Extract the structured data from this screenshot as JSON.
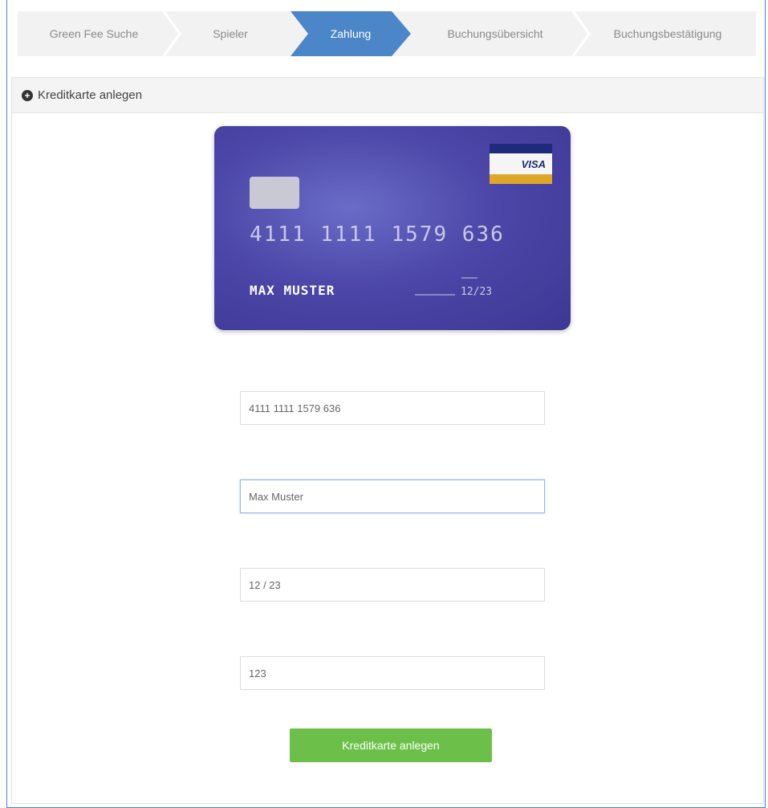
{
  "steps": [
    {
      "label": "Green Fee Suche",
      "active": false
    },
    {
      "label": "Spieler",
      "active": false
    },
    {
      "label": "Zahlung",
      "active": true
    },
    {
      "label": "Buchungsübersicht",
      "active": false
    },
    {
      "label": "Buchungsbestätigung",
      "active": false
    }
  ],
  "panel": {
    "title": "Kreditkarte anlegen",
    "icon": "plus-circle-icon"
  },
  "card_preview": {
    "brand": "VISA",
    "number": "4111 1111 1579 636",
    "holder": "MAX MUSTER",
    "expiry": "12/23",
    "colors": {
      "card": "#4c47a8",
      "visa_blue": "#1e2a7a",
      "visa_gold": "#e0a62a"
    }
  },
  "form": {
    "card_number": "4111 1111 1579 636",
    "holder_name": "Max Muster",
    "expiry": "12 / 23",
    "cvc": "123",
    "submit_label": "Kreditkarte anlegen"
  },
  "colors": {
    "active_step": "#4a86c8",
    "submit": "#6cc04a",
    "frame_border": "#4a7fc9"
  }
}
